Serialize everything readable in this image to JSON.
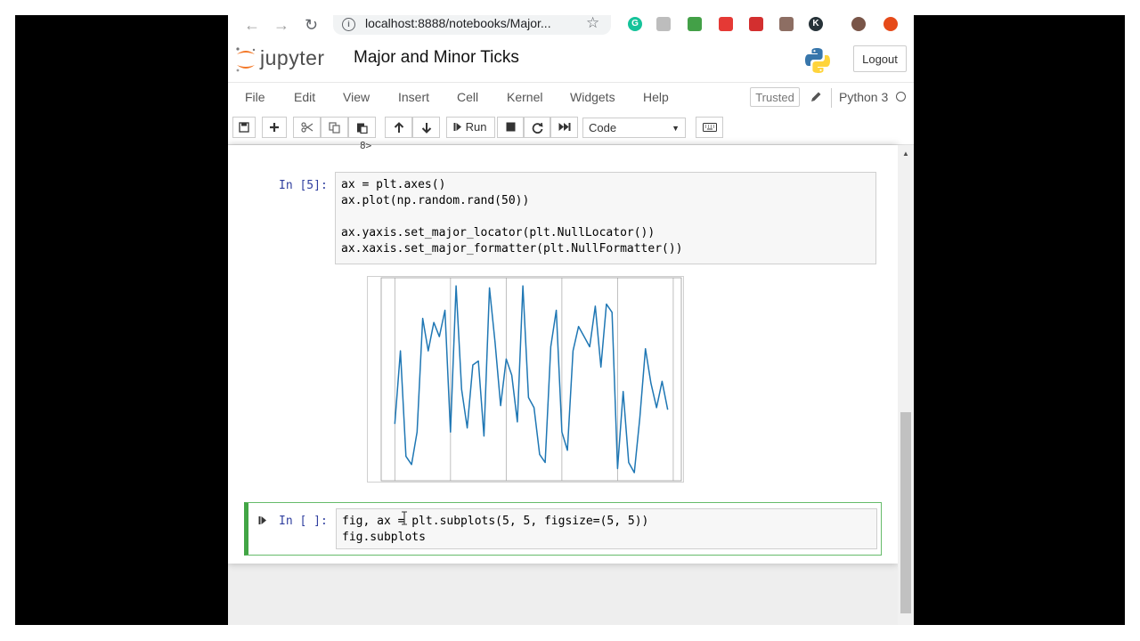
{
  "browser": {
    "url": "localhost:8888/notebooks/Major...",
    "info_icon_glyph": "i",
    "extensions": [
      {
        "name": "grammarly-extension-icon",
        "color": "#15c39a",
        "glyph": "G"
      },
      {
        "name": "extension-icon-gray",
        "color": "#bdbdbd",
        "glyph": ""
      },
      {
        "name": "extension-icon-green",
        "color": "#43a047",
        "glyph": ""
      },
      {
        "name": "extension-icon-red",
        "color": "#e53935",
        "glyph": ""
      },
      {
        "name": "extension-icon-shield",
        "color": "#d32f2f",
        "glyph": ""
      },
      {
        "name": "pdf-extension-icon",
        "color": "#8d6e63",
        "glyph": ""
      },
      {
        "name": "extension-icon-k",
        "color": "#263238",
        "glyph": "K"
      },
      {
        "name": "profile-avatar-icon",
        "color": "#795548",
        "glyph": ""
      },
      {
        "name": "extension-icon-orange",
        "color": "#e64a19",
        "glyph": ""
      }
    ]
  },
  "header": {
    "brand": "jupyter",
    "notebook_title": "Major and Minor Ticks",
    "logout_label": "Logout",
    "accent": "#f37726"
  },
  "menu": {
    "items": [
      "File",
      "Edit",
      "View",
      "Insert",
      "Cell",
      "Kernel",
      "Widgets",
      "Help"
    ],
    "trusted_label": "Trusted",
    "kernel_name": "Python 3"
  },
  "toolbar": {
    "run_label": "Run",
    "cell_type": "Code",
    "icons": [
      "save-icon",
      "plus-icon",
      "cut-icon",
      "copy-icon",
      "paste-icon",
      "arrow-up-icon",
      "arrow-down-icon",
      "run-icon",
      "stop-icon",
      "restart-icon",
      "fast-forward-icon",
      "keyboard-icon"
    ]
  },
  "cells": [
    {
      "prompt": "In [5]:",
      "lines": [
        "ax = plt.axes()",
        "ax.plot(np.random.rand(50))",
        "",
        "ax.yaxis.set_major_locator(plt.NullLocator())",
        "ax.xaxis.set_major_formatter(plt.NullFormatter())"
      ]
    },
    {
      "prompt": "In [ ]:",
      "lines": [
        "fig, ax = plt.subplots(5, 5, figsize=(5, 5))",
        "fig.subplots"
      ]
    }
  ],
  "previous_output_tail": "8>",
  "chart_data": {
    "type": "line",
    "x": [
      0,
      1,
      2,
      3,
      4,
      5,
      6,
      7,
      8,
      9,
      10,
      11,
      12,
      13,
      14,
      15,
      16,
      17,
      18,
      19,
      20,
      21,
      22,
      23,
      24,
      25,
      26,
      27,
      28,
      29,
      30,
      31,
      32,
      33,
      34,
      35,
      36,
      37,
      38,
      39,
      40,
      41,
      42,
      43,
      44,
      45,
      46,
      47,
      48,
      49
    ],
    "values": [
      0.28,
      0.64,
      0.12,
      0.08,
      0.24,
      0.8,
      0.64,
      0.78,
      0.71,
      0.84,
      0.24,
      0.96,
      0.45,
      0.26,
      0.57,
      0.59,
      0.22,
      0.95,
      0.68,
      0.37,
      0.6,
      0.52,
      0.29,
      0.96,
      0.41,
      0.36,
      0.13,
      0.09,
      0.66,
      0.84,
      0.24,
      0.15,
      0.64,
      0.76,
      0.71,
      0.66,
      0.86,
      0.56,
      0.87,
      0.83,
      0.06,
      0.44,
      0.09,
      0.04,
      0.31,
      0.65,
      0.48,
      0.36,
      0.49,
      0.35
    ],
    "series_color": "#1f77b4",
    "xlim": [
      -2.45,
      51.45
    ],
    "ylim": [
      0,
      1
    ],
    "x_grid_ticks": [
      0,
      10,
      20,
      30,
      40,
      50
    ],
    "xtick_labels_hidden": true,
    "yaxis_ticks_hidden": true,
    "title": "",
    "xlabel": "",
    "ylabel": ""
  }
}
